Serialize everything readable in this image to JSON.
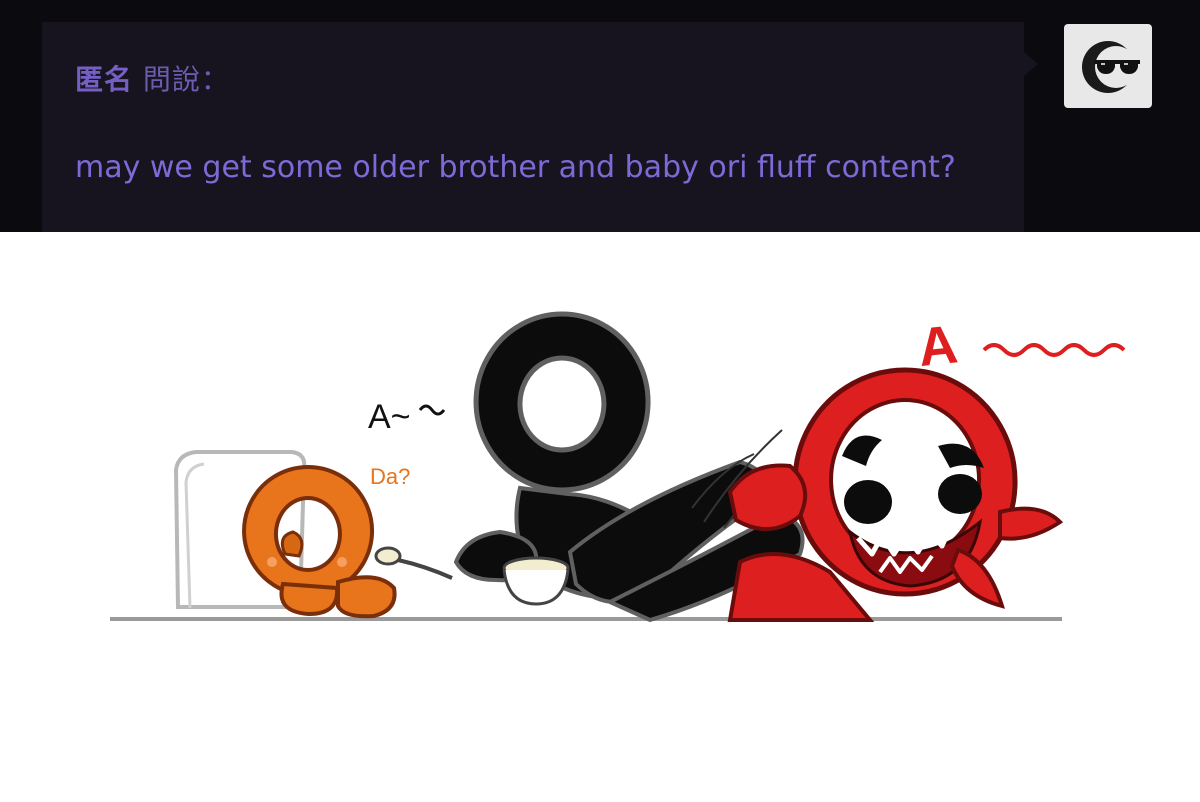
{
  "ask": {
    "asker_name": "匿名",
    "asker_verb": "問說：",
    "question": "may we get some older brother and baby ori fluff content?"
  },
  "avatar": {
    "icon": "sunglasses-moon-icon"
  },
  "comic": {
    "sfx_red": "A",
    "sfx_black": "A~",
    "baby_text": "Da?"
  },
  "colors": {
    "background_dark": "#0b0a0e",
    "bubble": "#18141f",
    "text_purple": "#7e6ad6",
    "orange": "#e8741c",
    "red": "#dd1f1f",
    "black": "#0c0c0c"
  }
}
